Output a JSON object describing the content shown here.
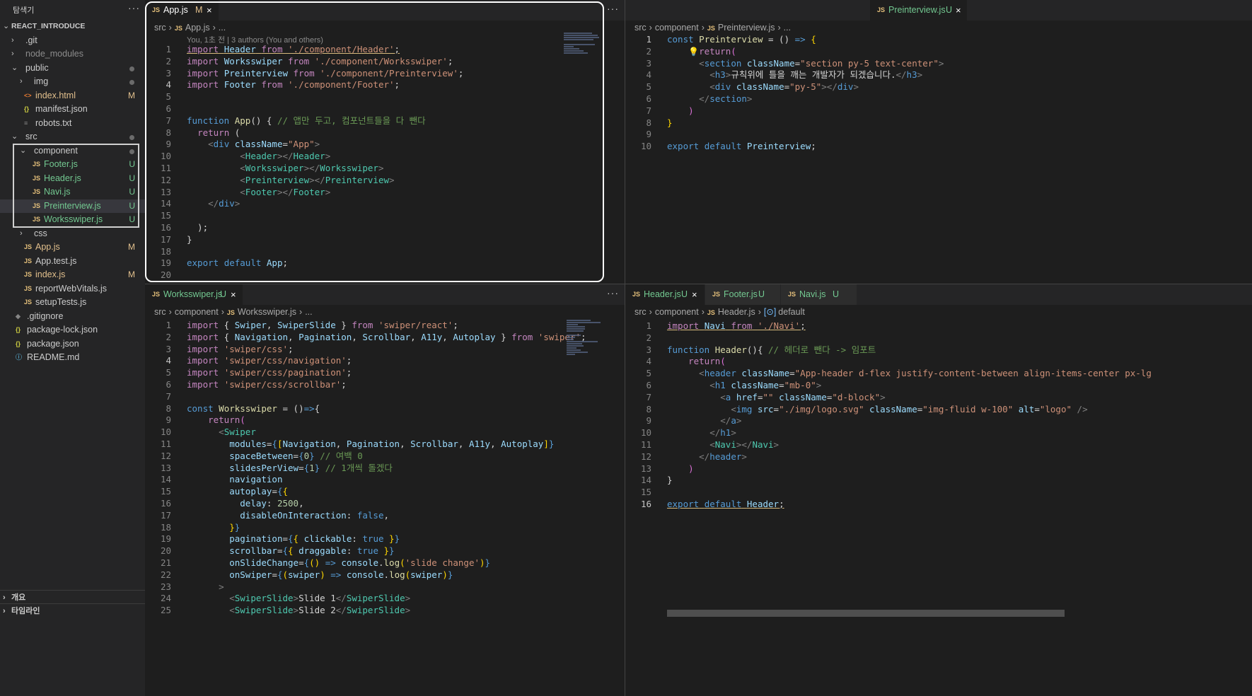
{
  "sidebar": {
    "title": "탐색기",
    "more": "···",
    "root": "REACT_INTRODUCE",
    "items": [
      {
        "label": ".git",
        "chev": "›",
        "status": ""
      },
      {
        "label": "node_modules",
        "chev": "›",
        "status": ""
      },
      {
        "label": "public",
        "chev": "⌄",
        "status": "dot"
      },
      {
        "label": "img",
        "chev": "›",
        "status": "dot"
      },
      {
        "label": "index.html",
        "icon": "<>",
        "status": "M"
      },
      {
        "label": "manifest.json",
        "icon": "{}",
        "status": ""
      },
      {
        "label": "robots.txt",
        "icon": "≡",
        "status": ""
      },
      {
        "label": "src",
        "chev": "⌄",
        "status": "dot"
      },
      {
        "label": "component",
        "chev": "⌄",
        "status": "dot"
      },
      {
        "label": "Footer.js",
        "icon": "JS",
        "status": "U"
      },
      {
        "label": "Header.js",
        "icon": "JS",
        "status": "U"
      },
      {
        "label": "Navi.js",
        "icon": "JS",
        "status": "U"
      },
      {
        "label": "Preinterview.js",
        "icon": "JS",
        "status": "U"
      },
      {
        "label": "Worksswiper.js",
        "icon": "JS",
        "status": "U"
      },
      {
        "label": "css",
        "chev": "›",
        "status": ""
      },
      {
        "label": "App.js",
        "icon": "JS",
        "status": "M"
      },
      {
        "label": "App.test.js",
        "icon": "JS",
        "status": ""
      },
      {
        "label": "index.js",
        "icon": "JS",
        "status": "M"
      },
      {
        "label": "reportWebVitals.js",
        "icon": "JS",
        "status": ""
      },
      {
        "label": "setupTests.js",
        "icon": "JS",
        "status": ""
      },
      {
        "label": ".gitignore",
        "icon": "◆",
        "status": ""
      },
      {
        "label": "package-lock.json",
        "icon": "{}",
        "status": ""
      },
      {
        "label": "package.json",
        "icon": "{}",
        "status": ""
      },
      {
        "label": "README.md",
        "icon": "ⓘ",
        "status": ""
      }
    ],
    "bottom": [
      "개요",
      "타임라인"
    ]
  },
  "editors": {
    "app": {
      "tab": {
        "name": "App.js",
        "status": "M",
        "close": "×"
      },
      "more": "···",
      "crumbs": [
        "src",
        "App.js",
        "..."
      ],
      "blame": "You, 1초 전 | 3 authors (You and others)"
    },
    "preinterview": {
      "tab": {
        "name": "Preinterview.js",
        "status": "U",
        "close": "×"
      },
      "crumbs": [
        "src",
        "component",
        "Preinterview.js",
        "..."
      ]
    },
    "worksswiper": {
      "tab": {
        "name": "Worksswiper.js",
        "status": "U",
        "close": "×"
      },
      "more": "···",
      "crumbs": [
        "src",
        "component",
        "Worksswiper.js",
        "..."
      ]
    },
    "header": {
      "tabs": [
        {
          "name": "Header.js",
          "status": "U",
          "close": "×"
        },
        {
          "name": "Footer.js",
          "status": "U"
        },
        {
          "name": "Navi.js",
          "status": "U"
        }
      ],
      "crumbs": [
        "src",
        "component",
        "Header.js",
        "default"
      ]
    }
  }
}
